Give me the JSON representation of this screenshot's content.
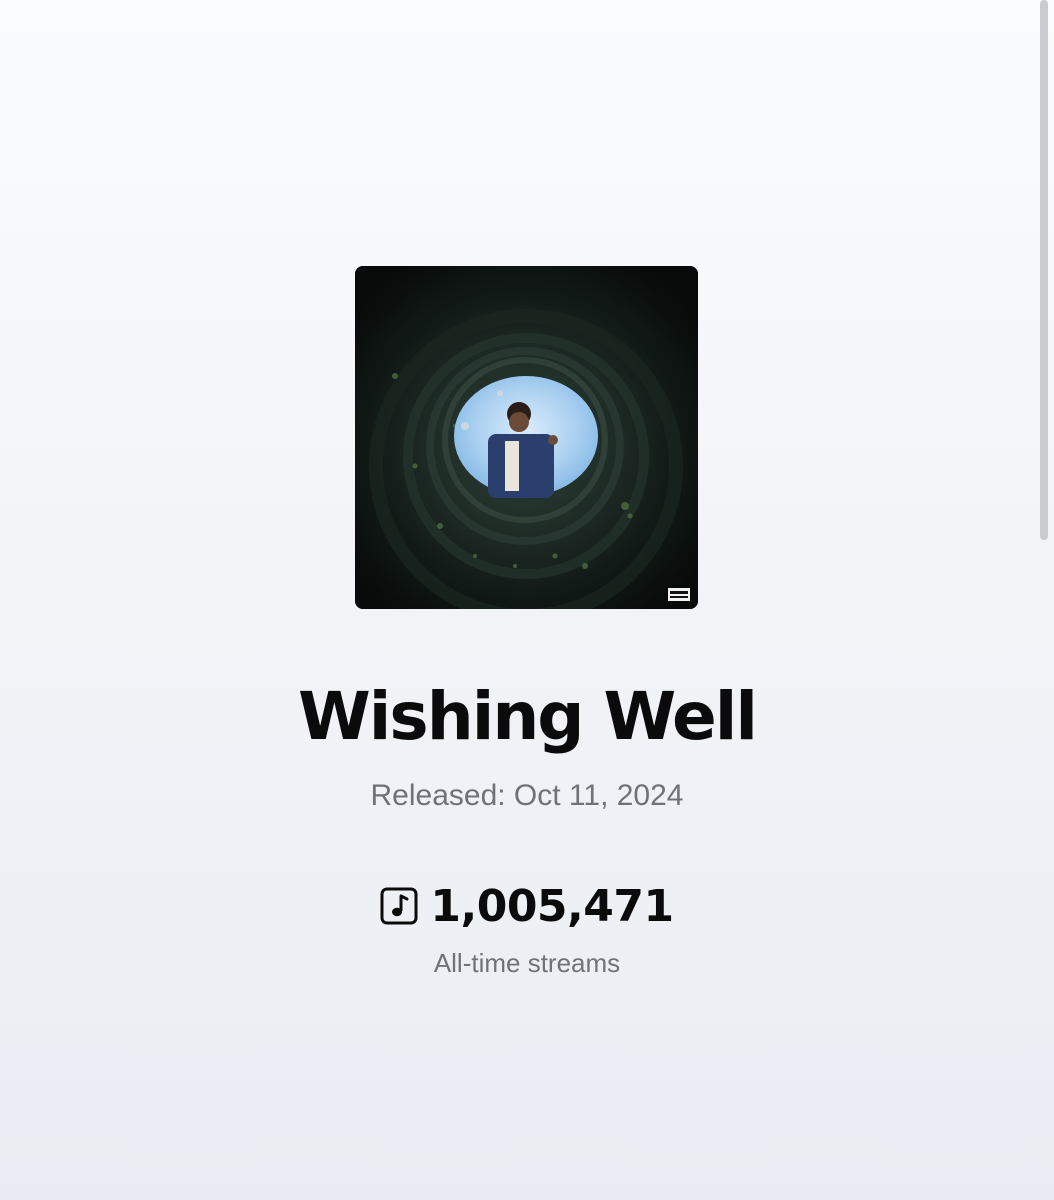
{
  "track": {
    "title": "Wishing Well",
    "released": "Released: Oct 11, 2024",
    "cover_icon": "album-cover-image"
  },
  "stats": {
    "streams_count": "1,005,471",
    "streams_label": "All-time streams",
    "streams_icon": "music-note-icon"
  },
  "colors": {
    "title": "#0b0b0c",
    "secondary_text": "#707276",
    "background": "#f3f5f8"
  }
}
